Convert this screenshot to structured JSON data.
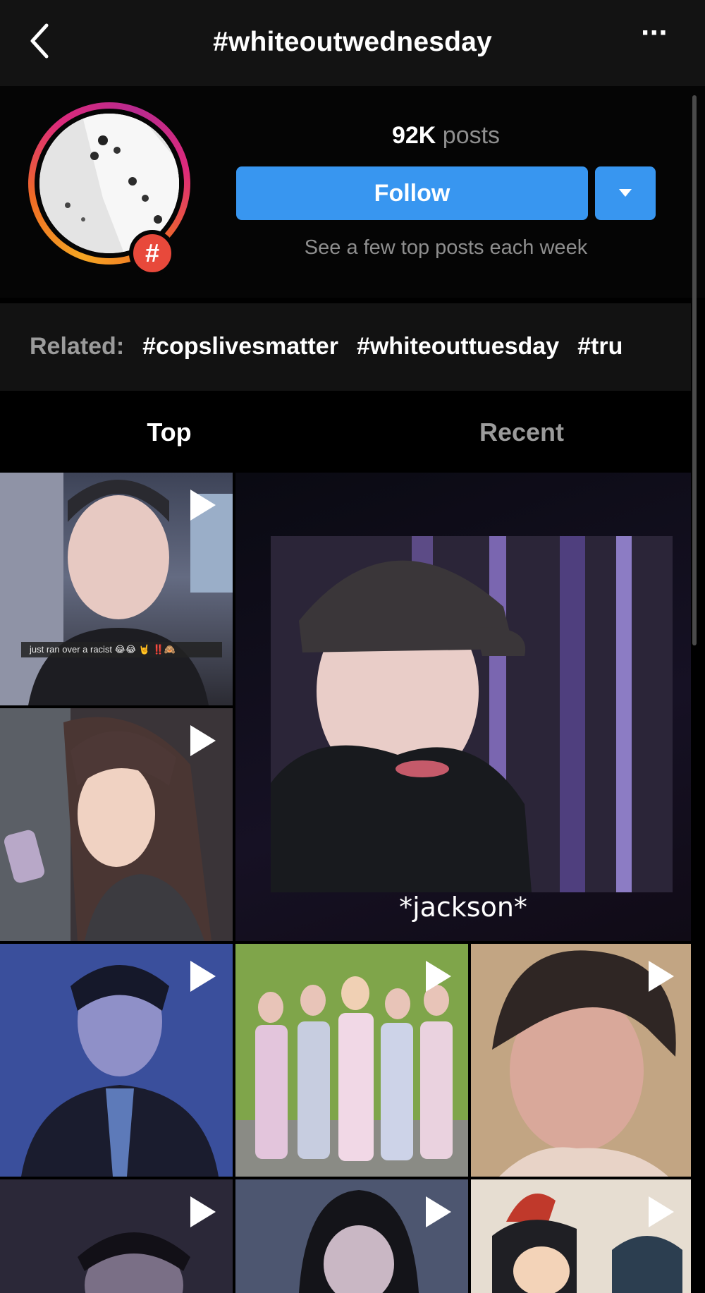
{
  "header": {
    "title": "#whiteoutwednesday",
    "more_label": "···"
  },
  "hashtag": {
    "badge_symbol": "#",
    "posts_count": "92K",
    "posts_label": "posts",
    "follow_label": "Follow",
    "hint": "See a few top posts each week"
  },
  "related": {
    "label": "Related:",
    "tags": [
      "#copslivesmatter",
      "#whiteouttuesday",
      "#tru"
    ]
  },
  "tabs": [
    {
      "label": "Top",
      "active": true
    },
    {
      "label": "Recent",
      "active": false
    }
  ],
  "grid": {
    "tile1_caption": "just ran over a racist 😂😂 🤘 ‼️🙈",
    "featured_caption": "*jackson*"
  },
  "colors": {
    "accent": "#3896f0",
    "badge": "#e8493b",
    "muted_text": "#8e8e8e"
  },
  "icons": {
    "back": "chevron-left-icon",
    "more": "more-horizontal-icon",
    "dropdown": "caret-down-icon",
    "video": "play-icon"
  }
}
